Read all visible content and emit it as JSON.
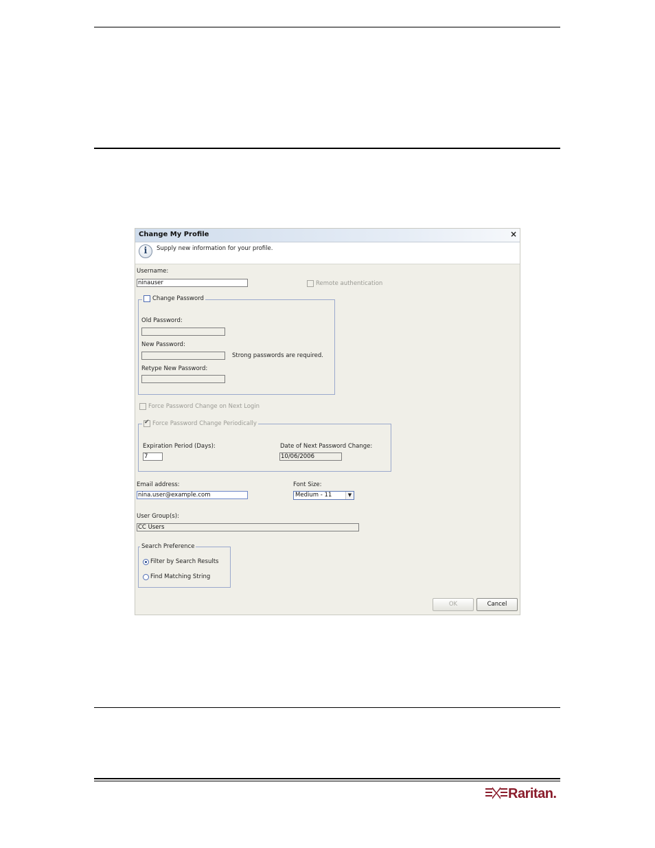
{
  "dialog": {
    "title": "Change My Profile",
    "close_glyph": "×",
    "info_text": "Supply new information for your profile.",
    "info_icon": "info-icon",
    "username_label": "Username:",
    "username_value": "ninauser",
    "remote_auth_label": "Remote authentication",
    "change_password": {
      "legend": "Change Password",
      "checked": false,
      "old_label": "Old Password:",
      "new_label": "New Password:",
      "strong_note": "Strong passwords are required.",
      "retype_label": "Retype New Password:"
    },
    "force_next_login_label": "Force Password Change on Next Login",
    "force_periodic": {
      "legend": "Force Password Change Periodically",
      "checked": true,
      "expiration_label": "Expiration Period (Days):",
      "expiration_value": "7",
      "next_date_label": "Date of Next Password Change:",
      "next_date_value": "10/06/2006"
    },
    "email_label": "Email address:",
    "email_value": "nina.user@example.com",
    "font_size_label": "Font Size:",
    "font_size_value": "Medium - 11",
    "user_groups_label": "User Group(s):",
    "user_groups_value": "CC Users",
    "search_pref": {
      "legend": "Search Preference",
      "options": [
        "Filter by Search Results",
        "Find Matching String"
      ],
      "selected": "Filter by Search Results"
    },
    "ok_label": "OK",
    "cancel_label": "Cancel"
  },
  "footer": {
    "brand": "Raritan."
  },
  "colors": {
    "dialog_bg": "#f0efe8",
    "group_border": "#9aa8cc",
    "brand": "#8a1c2b"
  }
}
